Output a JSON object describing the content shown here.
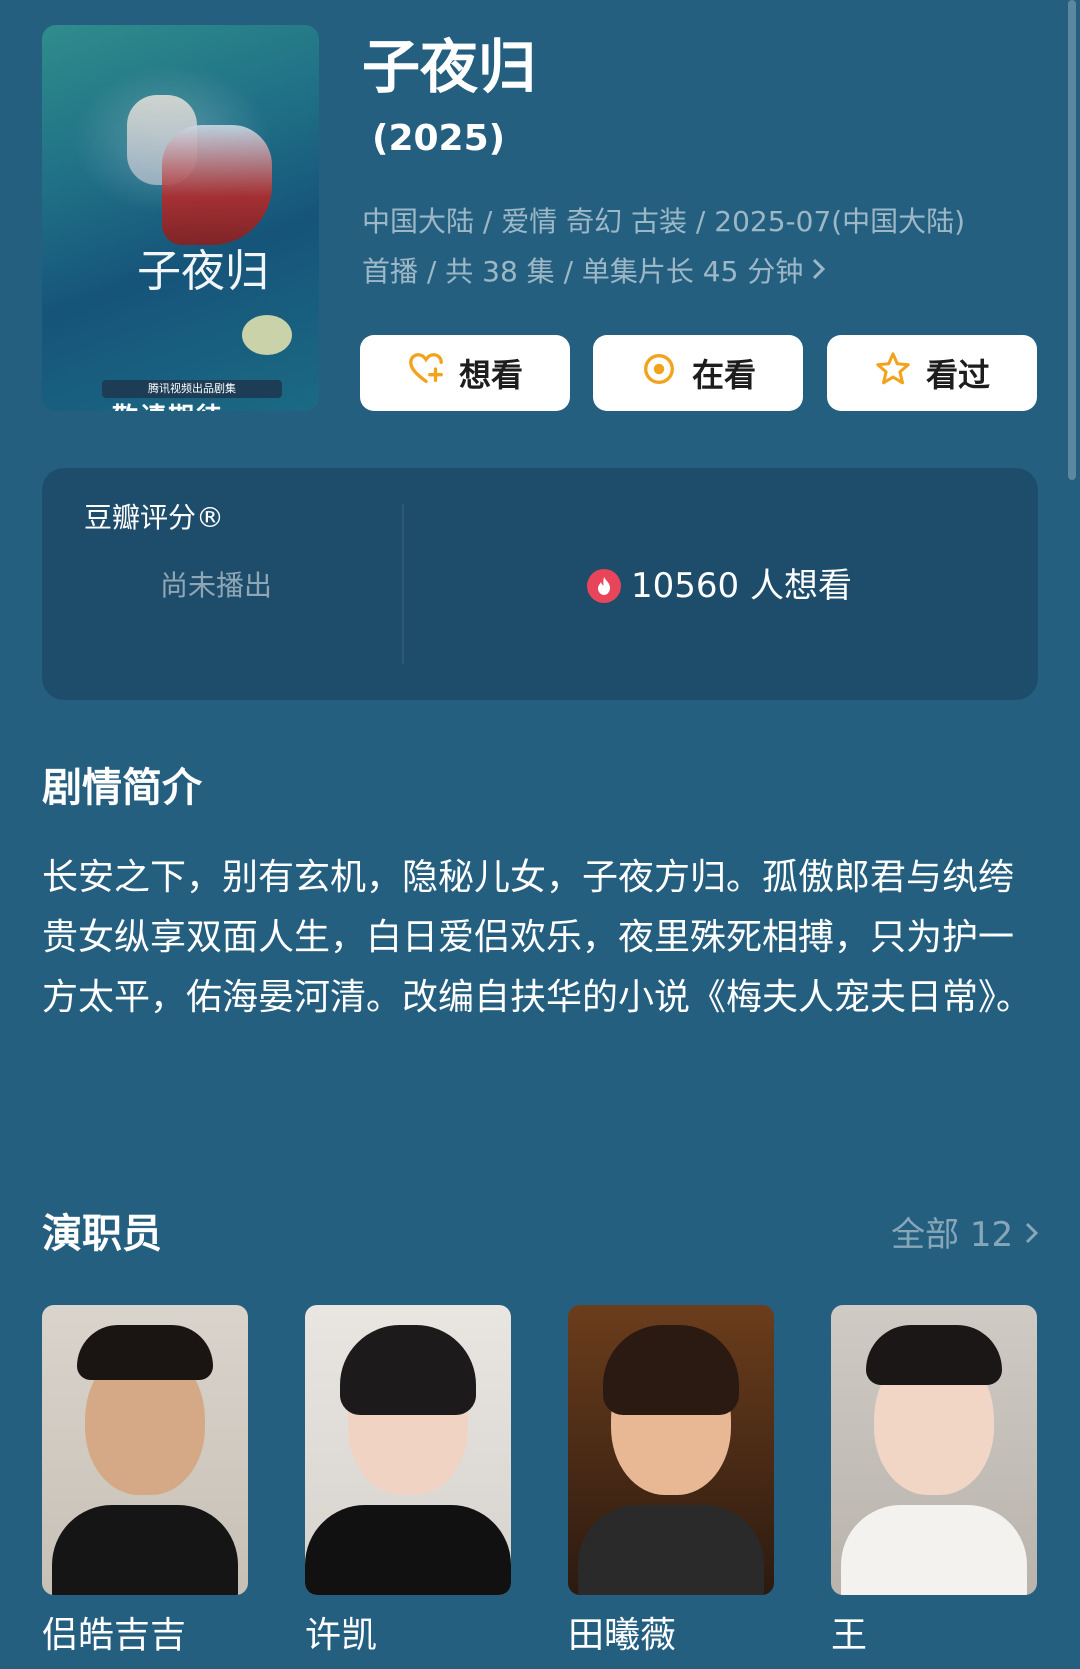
{
  "show": {
    "title": "子夜归",
    "year": "(2025)",
    "meta_line1": "中国大陆 / 爱情 奇幻 古装 / 2025-07(中国大陆)",
    "meta_line2": "首播 / 共 38 集 / 单集片长 45 分钟"
  },
  "poster": {
    "logo_text": "子夜归",
    "strip_text": "腾讯视频出品剧集",
    "expect_text": "敬请期待"
  },
  "actions": [
    {
      "label": "想看",
      "icon": "heart-plus-icon"
    },
    {
      "label": "在看",
      "icon": "target-icon"
    },
    {
      "label": "看过",
      "icon": "star-icon"
    }
  ],
  "rating": {
    "label": "豆瓣评分®",
    "status": "尚未播出",
    "wish_count_text": "10560 人想看"
  },
  "synopsis": {
    "heading": "剧情简介",
    "text": "长安之下，别有玄机，隐秘儿女，子夜方归。孤傲郎君与纨绔贵女纵享双面人生，白日爱侣欢乐，夜里殊死相搏，只为护一方太平，佑海晏河清。改编自扶华的小说《梅夫人宠夫日常》。"
  },
  "cast": {
    "heading": "演职员",
    "all_label": "全部 12",
    "members": [
      {
        "name": "侣皓吉吉"
      },
      {
        "name": "许凯"
      },
      {
        "name": "田曦薇"
      },
      {
        "name": "王"
      }
    ]
  },
  "colors": {
    "background": "#255f80",
    "card": "#1e4d6b",
    "accent_orange": "#f3a21b",
    "fire_red": "#e9455a"
  }
}
